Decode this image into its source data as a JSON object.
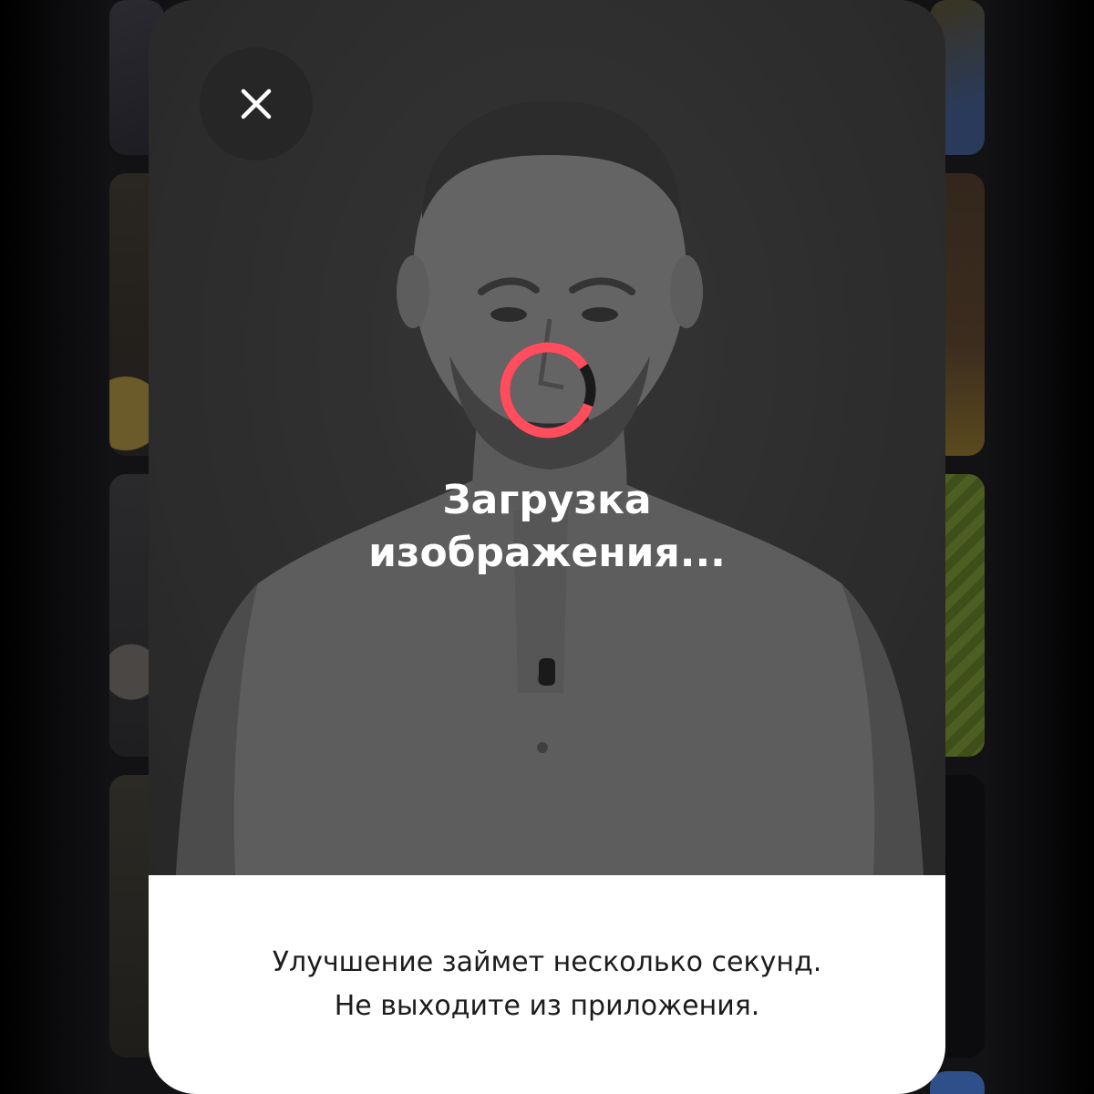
{
  "modal": {
    "close_icon": "close-icon",
    "loading": {
      "title": "Загрузка\nизображения...",
      "spinner_accent_color": "#ff4d5e",
      "spinner_track_color": "#1a1a1a",
      "progress_fraction": 0.85
    },
    "info": {
      "line1": "Улучшение займет несколько секунд.",
      "line2": "Не выходите из приложения."
    }
  },
  "colors": {
    "panel_background": "#ffffff",
    "text_dark": "#1c1c1c",
    "close_button_bg": "#262626"
  }
}
